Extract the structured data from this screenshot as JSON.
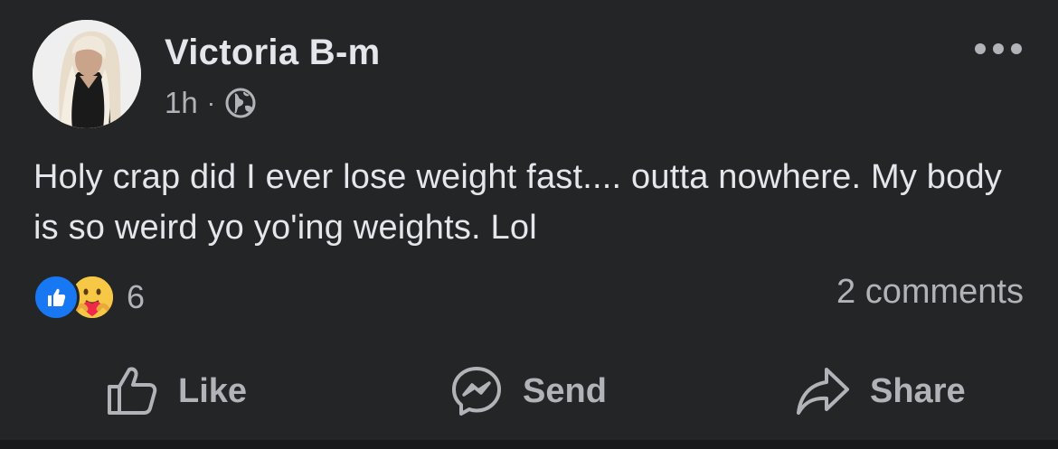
{
  "post": {
    "author": "Victoria B-m",
    "time": "1h",
    "separator": "·",
    "privacy_icon": "globe-icon",
    "text": "Holy crap did I ever lose weight fast.... outta nowhere. My body is so weird yo yo'ing weights. Lol",
    "reactions": {
      "icons": [
        "like-reaction-icon",
        "care-reaction-icon"
      ],
      "count": "6"
    },
    "comments_label": "2 comments"
  },
  "actions": {
    "like_label": "Like",
    "send_label": "Send",
    "share_label": "Share"
  },
  "colors": {
    "background": "#242526",
    "primary_text": "#e4e6eb",
    "secondary_text": "#b0b3b8",
    "like_blue": "#1877f2",
    "care_yellow": "#f7c845"
  }
}
